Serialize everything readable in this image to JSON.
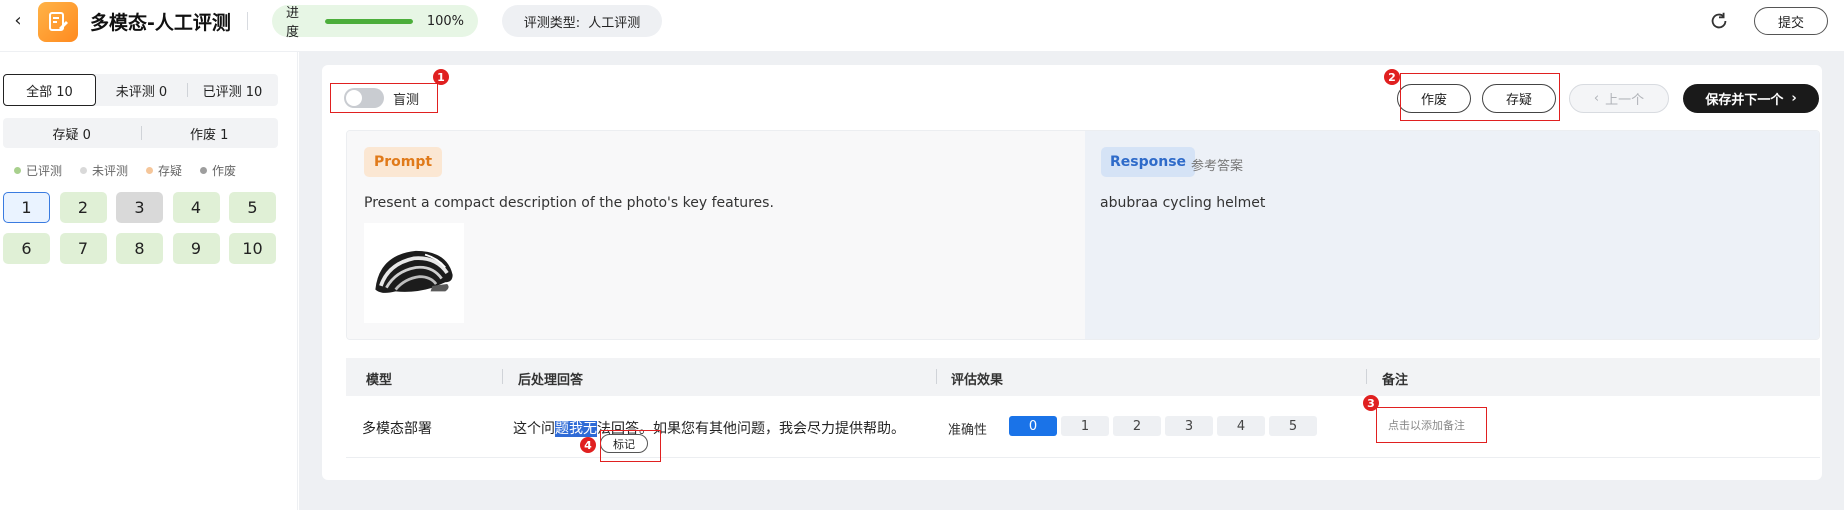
{
  "header": {
    "back_icon": "chevron-left-icon",
    "app_icon": "edit-document-icon",
    "title": "多模态-人工评测",
    "progress_label": "进度",
    "progress_value": 1.0,
    "progress_text": "100%",
    "eval_type_label": "评测类型:",
    "eval_type_value": "人工评测",
    "refresh_icon": "refresh-icon",
    "submit_label": "提交"
  },
  "sidebar": {
    "filters": [
      {
        "label": "全部 10",
        "active": true
      },
      {
        "label": "未评测 0",
        "active": false
      },
      {
        "label": "已评测 10",
        "active": false
      }
    ],
    "filters2": [
      {
        "label": "存疑 0"
      },
      {
        "label": "作废 1"
      }
    ],
    "legend": [
      {
        "label": "已评测",
        "color": "#a8d08d"
      },
      {
        "label": "未评测",
        "color": "#d9d9d9"
      },
      {
        "label": "存疑",
        "color": "#f5c69a"
      },
      {
        "label": "作废",
        "color": "#9e9e9e"
      }
    ],
    "items": [
      {
        "label": "1",
        "state": "current"
      },
      {
        "label": "2",
        "state": "evaluated"
      },
      {
        "label": "3",
        "state": "doubt"
      },
      {
        "label": "4",
        "state": "evaluated"
      },
      {
        "label": "5",
        "state": "evaluated"
      },
      {
        "label": "6",
        "state": "evaluated"
      },
      {
        "label": "7",
        "state": "evaluated"
      },
      {
        "label": "8",
        "state": "evaluated"
      },
      {
        "label": "9",
        "state": "evaluated"
      },
      {
        "label": "10",
        "state": "evaluated"
      }
    ]
  },
  "toolbar": {
    "blind_label": "盲测",
    "blind_on": false,
    "discard_label": "作废",
    "doubt_label": "存疑",
    "prev_label": "上一个",
    "next_label": "保存并下一个"
  },
  "annotations": [
    "1",
    "2",
    "3",
    "4"
  ],
  "prompt": {
    "tag": "Prompt",
    "text": "Present a compact description of the photo's key features.",
    "image_icon": "cycling-helmet-image"
  },
  "response": {
    "tag": "Response",
    "ref_label": "参考答案",
    "text": "abubraa cycling helmet"
  },
  "table": {
    "headers": [
      "模型",
      "后处理回答",
      "评估效果",
      "备注"
    ],
    "rows": [
      {
        "model": "多模态部署",
        "answer_pre": "这个问",
        "answer_highlight": "题我无",
        "answer_post": "法回答。如果您有其他问题，我会尽力提供帮助。",
        "mark_label": "标记",
        "metric_label": "准确性",
        "scores": [
          "0",
          "1",
          "2",
          "3",
          "4",
          "5"
        ],
        "selected_score": "0",
        "note_placeholder": "点击以添加备注"
      }
    ]
  }
}
